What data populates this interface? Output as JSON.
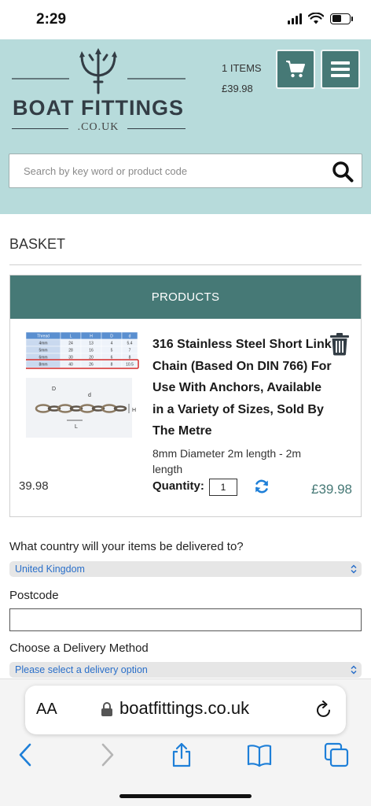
{
  "status_bar": {
    "time": "2:29"
  },
  "header": {
    "logo_title": "BOAT FITTINGS",
    "logo_subtitle": ".CO.UK",
    "cart_count": "1 ITEMS",
    "cart_total": "£39.98",
    "brand_color": "#467976",
    "background_color": "#b7dbdb"
  },
  "search": {
    "placeholder": "Search by key word or product code",
    "value": ""
  },
  "basket": {
    "title": "BASKET",
    "table_header": "PRODUCTS",
    "items": [
      {
        "name": "316 Stainless Steel Short Link Chain (Based On DIN 766) For Use With Anchors, Available in a Variety of Sizes, Sold By The Metre",
        "variant": "8mm Diameter 2m length - 2m length",
        "unit_price": "39.98",
        "quantity_label": "Quantity:",
        "quantity": "1",
        "line_total": "£39.98",
        "image_table": {
          "headers": [
            "Thread",
            "L",
            "H",
            "D",
            "d"
          ],
          "rows": [
            [
              "4mm",
              "24",
              "13",
              "4",
              "5.4"
            ],
            [
              "5mm",
              "28",
              "16",
              "5",
              "7"
            ],
            [
              "6mm",
              "30",
              "20",
              "6",
              "8"
            ],
            [
              "8mm",
              "40",
              "26",
              "8",
              "10.5"
            ]
          ],
          "highlighted_row": 3,
          "diagram_labels": [
            "D",
            "d",
            "L",
            "H"
          ]
        }
      }
    ]
  },
  "delivery": {
    "country_label": "What country will your items be delivered to?",
    "country_value": "United Kingdom",
    "postcode_label": "Postcode",
    "postcode_value": "",
    "method_label": "Choose a Delivery Method",
    "method_value": "Please select a delivery option"
  },
  "browser": {
    "text_size_label": "AA",
    "url": "boatfittings.co.uk"
  }
}
